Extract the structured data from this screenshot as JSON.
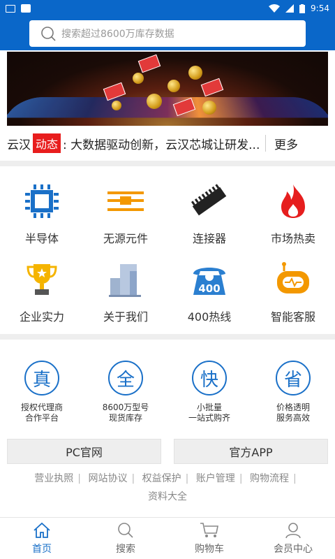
{
  "status_bar": {
    "time": "9:54"
  },
  "search": {
    "placeholder": "搜索超过8600万库存数据"
  },
  "news": {
    "brand": "云汉",
    "tag": "动态",
    "headline": ": 大数据驱动创新，云汉芯城让研发...",
    "more": "更多"
  },
  "categories": [
    {
      "label": "半导体",
      "icon": "chip-icon"
    },
    {
      "label": "无源元件",
      "icon": "resistor-icon"
    },
    {
      "label": "连接器",
      "icon": "connector-icon"
    },
    {
      "label": "市场热卖",
      "icon": "flame-icon"
    },
    {
      "label": "企业实力",
      "icon": "trophy-icon"
    },
    {
      "label": "关于我们",
      "icon": "building-icon"
    },
    {
      "label": "400热线",
      "icon": "phone-icon"
    },
    {
      "label": "智能客服",
      "icon": "robot-icon"
    }
  ],
  "features": [
    {
      "char": "真",
      "line1": "授权代理商",
      "line2": "合作平台"
    },
    {
      "char": "全",
      "line1": "8600万型号",
      "line2": "现货库存"
    },
    {
      "char": "快",
      "line1": "小批量",
      "line2": "一站式购齐"
    },
    {
      "char": "省",
      "line1": "价格透明",
      "line2": "服务高效"
    }
  ],
  "buttons": {
    "pc": "PC官网",
    "app": "官方APP"
  },
  "links": [
    "营业执照",
    "网站协议",
    "权益保护",
    "账户管理",
    "购物流程",
    "资料大全"
  ],
  "tabs": [
    {
      "label": "首页",
      "icon": "home-icon",
      "active": true
    },
    {
      "label": "搜索",
      "icon": "search-icon",
      "active": false
    },
    {
      "label": "购物车",
      "icon": "cart-icon",
      "active": false
    },
    {
      "label": "会员中心",
      "icon": "user-icon",
      "active": false
    }
  ],
  "colors": {
    "primary": "#0a67c9",
    "accent_red": "#e81d1d",
    "active_tab": "#1a70c8"
  }
}
